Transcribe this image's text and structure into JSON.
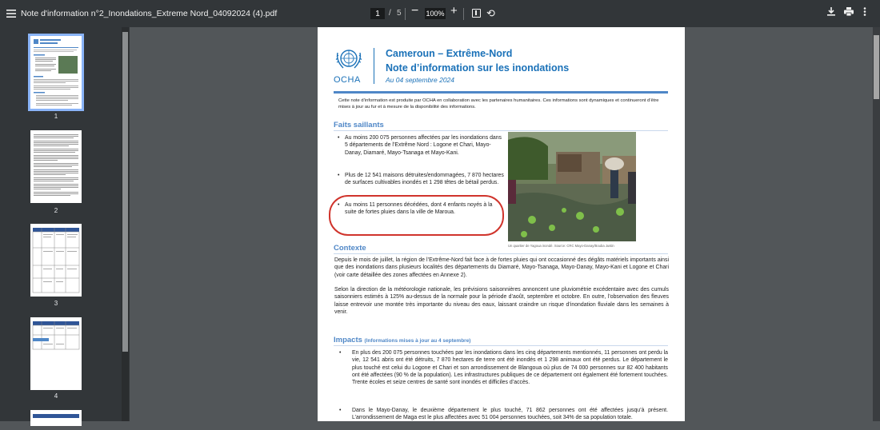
{
  "toolbar": {
    "file_title": "Note d'information n°2_Inondations_Extreme Nord_04092024 (4).pdf",
    "current_page": "1",
    "separator": "/",
    "total_pages": "5",
    "zoom": "100%",
    "zoom_out": "−",
    "zoom_in": "+"
  },
  "sidebar": {
    "pages": [
      "1",
      "2",
      "3",
      "4"
    ]
  },
  "document": {
    "org": "OCHA",
    "title": "Cameroun – Extrême-Nord",
    "subtitle": "Note d’information sur les inondations",
    "date": "Au 04 septembre 2024",
    "intro": "Cette note d’information est produite par OCHA en collaboration avec les partenaires humanitaires. Ces informations sont dynamiques et continueront d’être mises à jour au fur et à mesure de la disponibilité des informations.",
    "highlights_heading": "Faits saillants",
    "highlights": [
      "Au moins 200 075 personnes affectées par les inondations dans 5 départements de l’Extrême Nord : Logone et Chari, Mayo-Danay, Diamaré, Mayo-Tsanaga et Mayo-Kani.",
      "Plus de 12 541 maisons détruites/endommagées, 7 870 hectares de surfaces cultivables inondés et 1 298 têtes de bétail perdus.",
      "Au moins 11 personnes décédées, dont 4 enfants noyés à la suite de fortes pluies dans la ville de Maroua."
    ],
    "photo_caption": "Un quartier de Yagoua inondé. Source: CRC Mayo-Danay/Bouba Justin",
    "context_heading": "Contexte",
    "context_paragraphs": [
      "Depuis le mois de juillet, la région de l’Extrême-Nord fait face à de fortes pluies qui ont occasionné des dégâts matériels importants ainsi que des inondations dans plusieurs localités des départements du Diamaré, Mayo-Tsanaga, Mayo-Danay, Mayo-Kani et Logone et Chari (voir carte détaillée des zones affectées en Annexe 2).",
      "Selon la direction de la météorologie nationale, les prévisions saisonnières annoncent une pluviométrie excédentaire avec des cumuls saisonniers estimés à 125% au-dessus de la normale pour la période d’août, septembre et octobre. En outre, l’observation des fleuves laisse entrevoir une montée très importante du niveau des eaux, laissant craindre un risque d’inondation fluviale dans les semaines à venir."
    ],
    "impacts_heading": "Impacts",
    "impacts_note": "(Informations mises à jour au 4 septembre)",
    "impacts": [
      "En plus des 200 075 personnes touchées par les inondations dans les cinq départements mentionnés, 11 personnes ont perdu la vie, 12 541 abris ont été détruits, 7 870 hectares de terre ont été inondés et 1 298 animaux ont été perdus. Le département le plus touché est celui du Logone et Chari et son arrondissement de Blangoua où plus de 74 000 personnes sur 82 400 habitants ont été affectées (90 % de la population). Les infrastructures publiques de ce département ont également été fortement touchées. Trente écoles et seize centres de santé sont inondés et difficiles d’accès.",
      "Dans le Mayo-Danay, le deuxième département le plus touché, 71 862 personnes ont été affectées jusqu’à présent. L’arrondissement de Maga est le plus affectées avec 51 004 personnes touchées, soit 34% de sa population totale."
    ]
  },
  "colors": {
    "toolbar_bg": "#323639",
    "viewer_bg": "#525659",
    "ocha_blue": "#1a71b8",
    "annotation_red": "#d0342c",
    "thumb_selected": "#8ab4f8"
  }
}
